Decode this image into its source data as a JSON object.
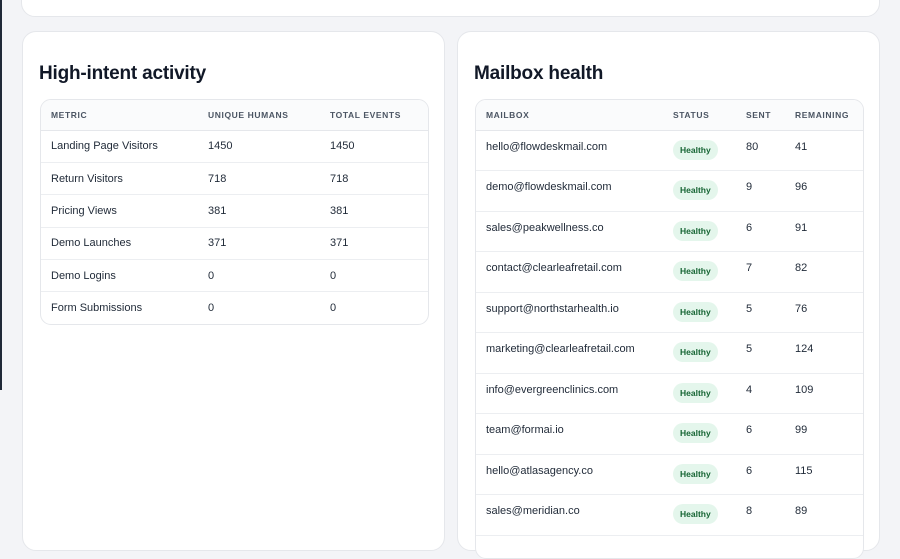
{
  "activity": {
    "title": "High-intent activity",
    "columns": [
      "METRIC",
      "UNIQUE HUMANS",
      "TOTAL EVENTS"
    ],
    "rows": [
      {
        "metric": "Landing Page Visitors",
        "unique": "1450",
        "total": "1450"
      },
      {
        "metric": "Return Visitors",
        "unique": "718",
        "total": "718"
      },
      {
        "metric": "Pricing Views",
        "unique": "381",
        "total": "381"
      },
      {
        "metric": "Demo Launches",
        "unique": "371",
        "total": "371"
      },
      {
        "metric": "Demo Logins",
        "unique": "0",
        "total": "0"
      },
      {
        "metric": "Form Submissions",
        "unique": "0",
        "total": "0"
      }
    ]
  },
  "mailbox": {
    "title": "Mailbox health",
    "columns": [
      "MAILBOX",
      "STATUS",
      "SENT",
      "REMAINING"
    ],
    "rows": [
      {
        "mailbox": "hello@flowdeskmail.com",
        "status": "Healthy",
        "sent": "80",
        "remaining": "41"
      },
      {
        "mailbox": "demo@flowdeskmail.com",
        "status": "Healthy",
        "sent": "9",
        "remaining": "96"
      },
      {
        "mailbox": "sales@peakwellness.co",
        "status": "Healthy",
        "sent": "6",
        "remaining": "91"
      },
      {
        "mailbox": "contact@clearleafretail.com",
        "status": "Healthy",
        "sent": "7",
        "remaining": "82"
      },
      {
        "mailbox": "support@northstarhealth.io",
        "status": "Healthy",
        "sent": "5",
        "remaining": "76"
      },
      {
        "mailbox": "marketing@clearleafretail.com",
        "status": "Healthy",
        "sent": "5",
        "remaining": "124"
      },
      {
        "mailbox": "info@evergreenclinics.com",
        "status": "Healthy",
        "sent": "4",
        "remaining": "109"
      },
      {
        "mailbox": "team@formai.io",
        "status": "Healthy",
        "sent": "6",
        "remaining": "99"
      },
      {
        "mailbox": "hello@atlasagency.co",
        "status": "Healthy",
        "sent": "6",
        "remaining": "115"
      },
      {
        "mailbox": "sales@meridian.co",
        "status": "Healthy",
        "sent": "8",
        "remaining": "89"
      }
    ]
  },
  "colors": {
    "badge_bg": "#e4f6ec",
    "badge_text": "#166534",
    "page_bg": "#f3f4f7"
  }
}
